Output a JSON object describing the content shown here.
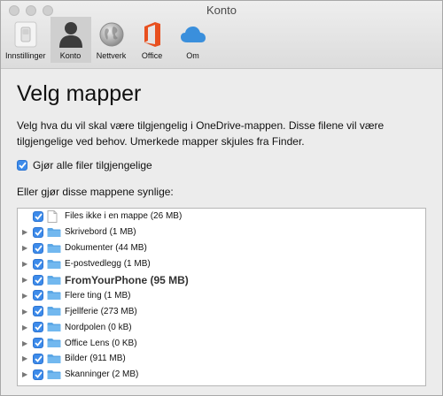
{
  "window": {
    "title": "Konto"
  },
  "toolbar": {
    "items": [
      {
        "label": "Innstillinger",
        "icon": "switch-icon",
        "active": false
      },
      {
        "label": "Konto",
        "icon": "person-icon",
        "active": true
      },
      {
        "label": "Nettverk",
        "icon": "globe-icon",
        "active": false
      },
      {
        "label": "Office",
        "icon": "office-icon",
        "active": false
      },
      {
        "label": "Om",
        "icon": "cloud-icon",
        "active": false
      }
    ]
  },
  "main": {
    "heading": "Velg mapper",
    "description": "Velg hva du vil skal være tilgjengelig i OneDrive-mappen. Disse filene vil være tilgjengelige ved behov. Umerkede mapper skjules fra Finder.",
    "make_all_label": "Gjør alle filer tilgjengelige",
    "make_all_checked": true,
    "or_label": "Eller gjør disse mappene synlige:"
  },
  "folders": [
    {
      "name": "Files ikke i en mappe (26 MB)",
      "type": "file",
      "expandable": false,
      "checked": true
    },
    {
      "name": "Skrivebord (1 MB)",
      "type": "folder",
      "expandable": true,
      "checked": true
    },
    {
      "name": "Dokumenter (44 MB)",
      "type": "folder",
      "expandable": true,
      "checked": true
    },
    {
      "name": "E-postvedlegg (1 MB)",
      "type": "folder",
      "expandable": true,
      "checked": true
    },
    {
      "name": "FromYourPhone  (95 MB)",
      "type": "folder",
      "expandable": true,
      "checked": true,
      "emphasis": true
    },
    {
      "name": "Flere ting (1 MB)",
      "type": "folder",
      "expandable": true,
      "checked": true
    },
    {
      "name": "Fjellferie (273 MB)",
      "type": "folder",
      "expandable": true,
      "checked": true
    },
    {
      "name": "Nordpolen (0 kB)",
      "type": "folder",
      "expandable": true,
      "checked": true
    },
    {
      "name": "Office Lens (0 KB)",
      "type": "folder",
      "expandable": true,
      "checked": true
    },
    {
      "name": "Bilder (911 MB)",
      "type": "folder",
      "expandable": true,
      "checked": true
    },
    {
      "name": "Skanninger (2 MB)",
      "type": "folder",
      "expandable": true,
      "checked": true
    }
  ],
  "colors": {
    "checkbox": "#3d8bea",
    "folder": "#5ba7e6",
    "office": "#e8501f",
    "cloud": "#3a8fdc"
  }
}
